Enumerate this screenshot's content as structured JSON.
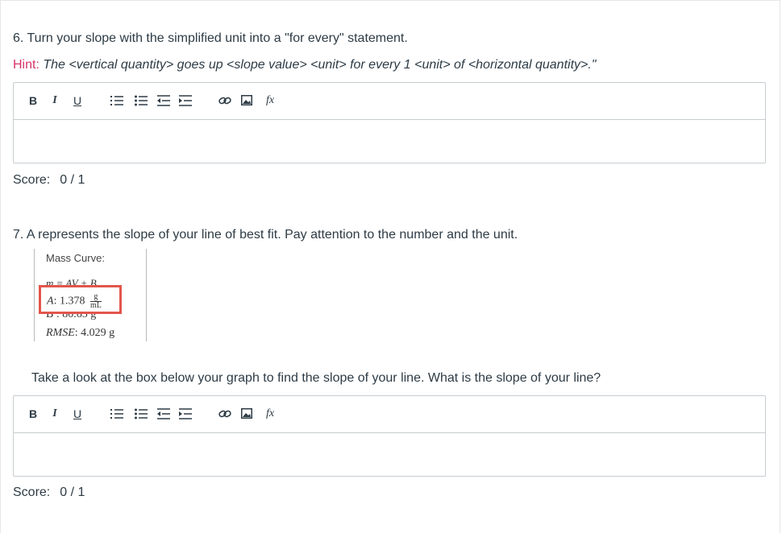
{
  "q6": {
    "text": "6. Turn your slope with the simplified unit into a \"for every\" statement.",
    "hint_label": "Hint:",
    "hint_body": "The <vertical quantity> goes up <slope value> <unit> for every 1 <unit> of <horizontal quantity>.\"",
    "score_label": "Score:",
    "score_value": "0 / 1"
  },
  "q7": {
    "text": "7. A represents the slope of your line of best fit. Pay attention to the number and the unit.",
    "followup": "Take a look at the box below your graph to find the slope of your line. What is the slope of your line?",
    "score_label": "Score:",
    "score_value": "0 / 1"
  },
  "figure": {
    "title": "Mass Curve:",
    "equation": "m = AV + B",
    "a_label": "A",
    "a_value": ": 1.378",
    "a_unit_num": "g",
    "a_unit_den": "mL",
    "b_line": "B : 80.65 g",
    "rmse_label": "RMSE",
    "rmse_value": ": 4.029 g"
  },
  "toolbar": {
    "bold": "B",
    "italic": "I",
    "underline": "U",
    "fx": "fx",
    "icons": [
      "ordered-list-icon",
      "unordered-list-icon",
      "outdent-icon",
      "indent-icon",
      "link-icon",
      "image-icon",
      "formula-icon"
    ]
  },
  "colors": {
    "hint": "#d6336c",
    "highlight_box": "#e2564b",
    "text": "#2d3b45",
    "border": "#c7cdd1"
  }
}
